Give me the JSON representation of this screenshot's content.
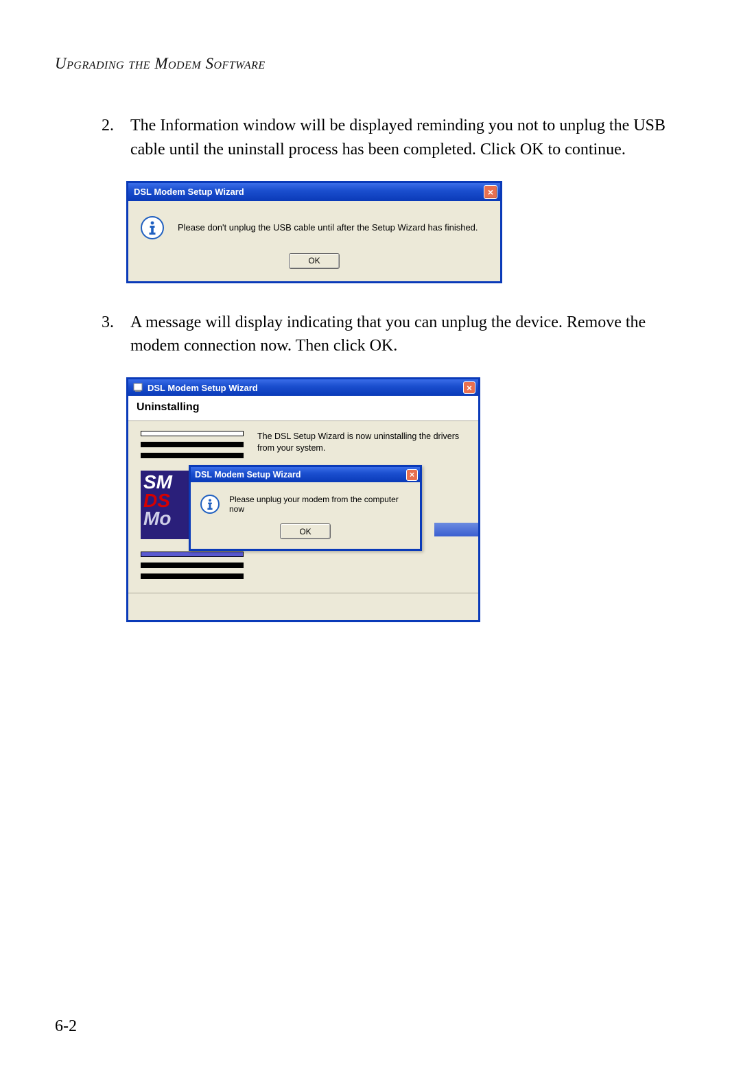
{
  "page": {
    "header": "Upgrading the Modem Software",
    "number": "6-2"
  },
  "steps": [
    {
      "num": "2.",
      "text": "The Information window will be displayed reminding you not to unplug the USB cable until the uninstall process has been completed. Click OK to continue."
    },
    {
      "num": "3.",
      "text": "A message will display indicating that you can unplug the device. Remove the modem connection now. Then click OK."
    }
  ],
  "dialog1": {
    "title": "DSL Modem Setup Wizard",
    "message": "Please don't unplug the USB cable until after the Setup Wizard has finished.",
    "ok_label": "OK",
    "close_label": "×"
  },
  "wizard": {
    "title": "DSL Modem Setup Wizard",
    "heading": "Uninstalling",
    "message": "The DSL Setup Wizard is now uninstalling the drivers from your system.",
    "close_label": "×",
    "brand_lines": {
      "l1": "SM",
      "l2": "DS",
      "l3": "Mo"
    }
  },
  "inner_dialog": {
    "title": "DSL Modem Setup Wizard",
    "message": "Please unplug your modem from the computer now",
    "ok_label": "OK",
    "close_label": "×"
  }
}
